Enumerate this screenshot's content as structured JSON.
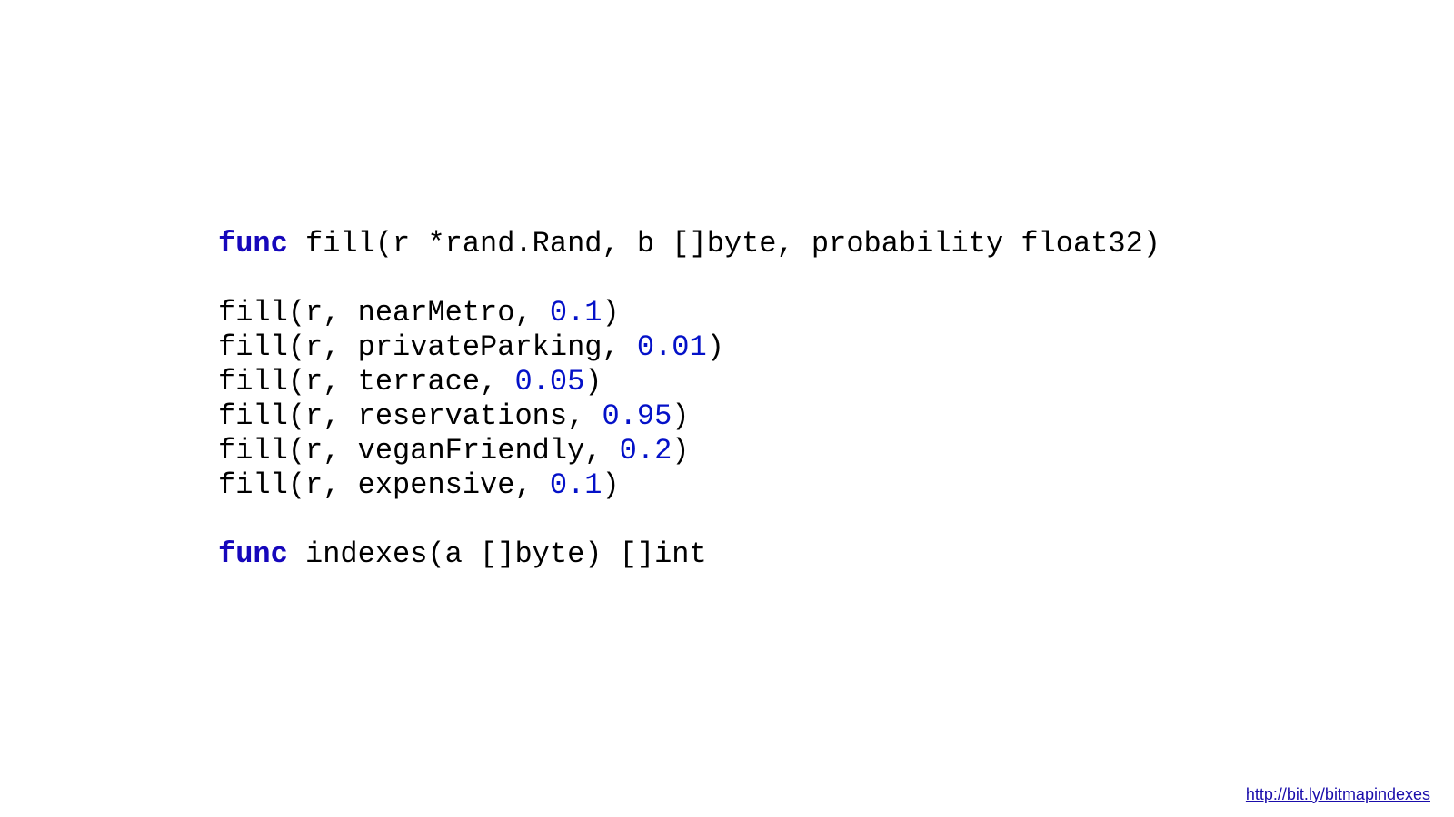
{
  "code": {
    "sig1_kw": "func",
    "sig1_rest": " fill(r *rand.Rand, b []byte, probability float32)",
    "call1_a": "fill(r, nearMetro, ",
    "call1_n": "0.1",
    "call1_b": ")",
    "call2_a": "fill(r, privateParking, ",
    "call2_n": "0.01",
    "call2_b": ")",
    "call3_a": "fill(r, terrace, ",
    "call3_n": "0.05",
    "call3_b": ")",
    "call4_a": "fill(r, reservations, ",
    "call4_n": "0.95",
    "call4_b": ")",
    "call5_a": "fill(r, veganFriendly, ",
    "call5_n": "0.2",
    "call5_b": ")",
    "call6_a": "fill(r, expensive, ",
    "call6_n": "0.1",
    "call6_b": ")",
    "sig2_kw": "func",
    "sig2_rest": " indexes(a []byte) []int"
  },
  "footer": {
    "link_text": "http://bit.ly/bitmapindexes"
  }
}
